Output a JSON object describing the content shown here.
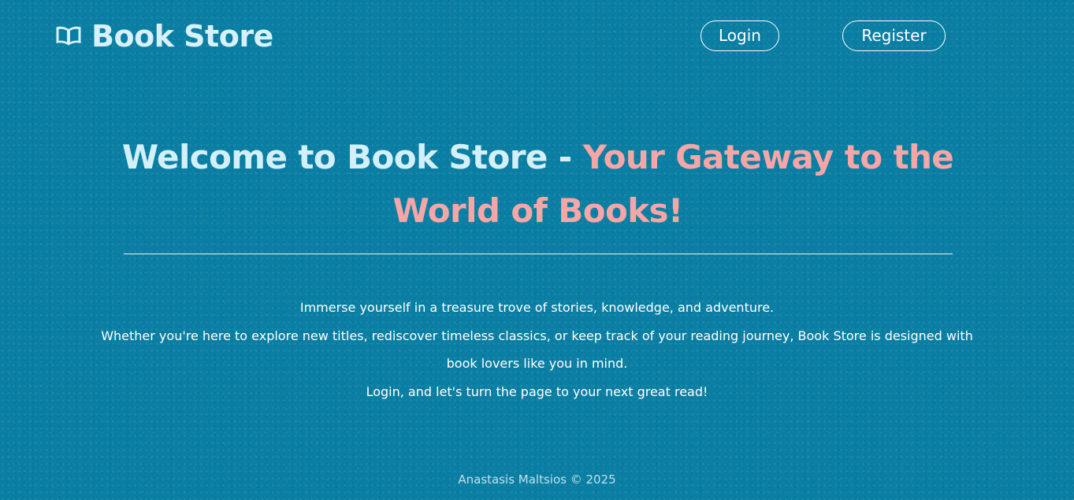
{
  "header": {
    "brand_title": "Book Store",
    "login_label": "Login",
    "register_label": "Register"
  },
  "hero": {
    "title_lead": "Welcome to Book Store - ",
    "title_highlight": "Your Gateway to the World of Books!"
  },
  "intro": {
    "line1": "Immerse yourself in a treasure trove of stories, knowledge, and adventure.",
    "line2": "Whether you're here to explore new titles, rediscover timeless classics, or keep track of your reading journey, Book Store is designed with book lovers like you in mind.",
    "line3": "Login, and let's turn the page to your next great read!"
  },
  "footer": {
    "text": "Anastasis Maltsios © 2025"
  },
  "colors": {
    "background": "#0b7fa3",
    "title_lead": "#d3f0fa",
    "title_highlight": "#f6a6a6",
    "text": "#ffffff"
  },
  "icons": {
    "brand": "open-book-icon"
  }
}
